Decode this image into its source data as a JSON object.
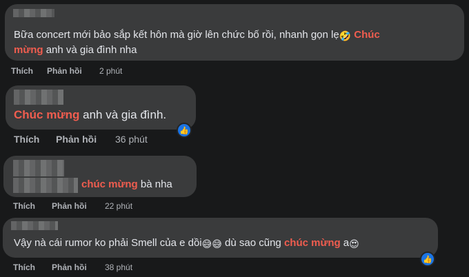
{
  "comments": [
    {
      "text": "Bữa concert mới bảo sắp kết hôn mà giờ lên chức bố rồi, nhanh gọn lẹ",
      "emoji1": "🤣",
      "accent1": "Chúc",
      "line2_accent": "mừng",
      "line2_rest": " anh và gia đình nha",
      "like": "Thích",
      "reply": "Phản hồi",
      "time": "2 phút"
    },
    {
      "accent": "Chúc mừng",
      "rest": " anh và gia đình.",
      "like": "Thích",
      "reply": "Phản hồi",
      "time": "36 phút",
      "reaction_icon": "thumbs-up-icon"
    },
    {
      "accent": "chúc mừng",
      "rest": " bà nha",
      "like": "Thích",
      "reply": "Phản hồi",
      "time": "22 phút"
    },
    {
      "text": "Vậy nà cái rumor ko phải Smell của e dồi",
      "emoji1": "😅",
      "emoji2": "😅",
      "mid": " dù sao cũng ",
      "accent": "chúc mừng",
      "end": " a",
      "emoji3": "😍",
      "like": "Thích",
      "reply": "Phản hồi",
      "time": "38 phút",
      "reaction_icon": "thumbs-up-icon"
    }
  ],
  "colors": {
    "background": "#18191a",
    "bubble": "#3a3b3c",
    "accent": "#f05d4f",
    "like_blue": "#1b74e4"
  }
}
